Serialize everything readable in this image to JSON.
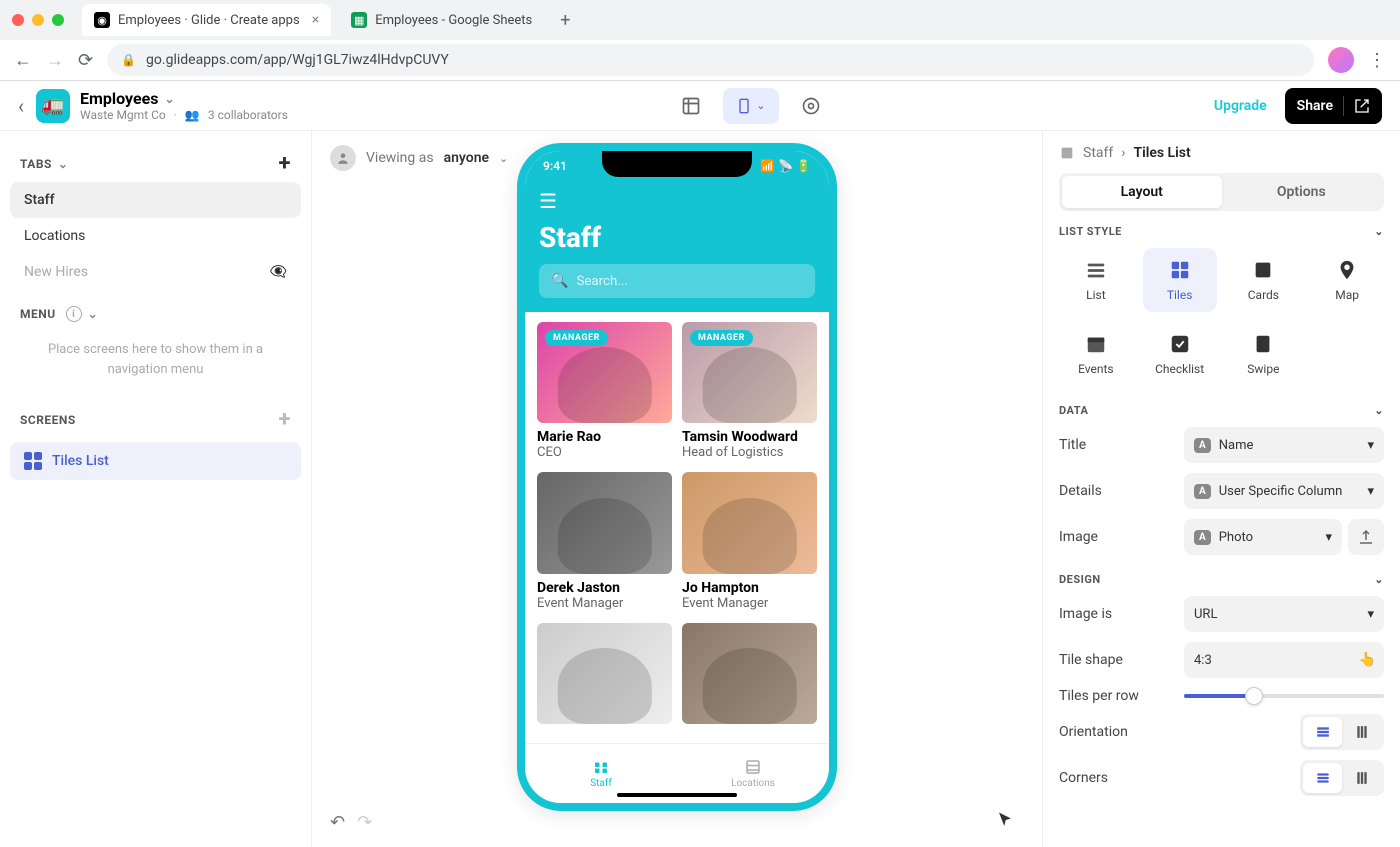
{
  "browser": {
    "tabs": [
      {
        "favicon": "◉",
        "title": "Employees · Glide · Create apps",
        "active": true
      },
      {
        "favicon": "▦",
        "title": "Employees - Google Sheets",
        "active": false
      }
    ],
    "url": "go.glideapps.com/app/Wgj1GL7iwz4lHdvpCUVY"
  },
  "app_header": {
    "title": "Employees",
    "org": "Waste Mgmt Co",
    "collaborators": "3 collaborators",
    "upgrade": "Upgrade",
    "share": "Share"
  },
  "left": {
    "tabs_label": "TABS",
    "tabs": [
      {
        "name": "Staff",
        "active": true
      },
      {
        "name": "Locations"
      },
      {
        "name": "New Hires",
        "hidden": true
      }
    ],
    "menu_label": "MENU",
    "menu_help": "Place screens here to show them in a navigation menu",
    "screens_label": "SCREENS",
    "screens": [
      {
        "name": "Tiles List",
        "active": true
      }
    ]
  },
  "viewing": {
    "prefix": "Viewing as",
    "who": "anyone"
  },
  "phone": {
    "time": "9:41",
    "title": "Staff",
    "search_placeholder": "Search...",
    "manager_badge": "MANAGER",
    "people": [
      {
        "name": "Marie Rao",
        "role": "CEO",
        "badge": true
      },
      {
        "name": "Tamsin Woodward",
        "role": "Head of Logistics",
        "badge": true
      },
      {
        "name": "Derek Jaston",
        "role": "Event Manager"
      },
      {
        "name": "Jo Hampton",
        "role": "Event Manager"
      }
    ],
    "nav": [
      {
        "label": "Staff",
        "active": true
      },
      {
        "label": "Locations"
      }
    ]
  },
  "right": {
    "crumb_root": "Staff",
    "crumb_current": "Tiles List",
    "layout_tab": "Layout",
    "options_tab": "Options",
    "list_style_label": "LIST STYLE",
    "styles": [
      "List",
      "Tiles",
      "Cards",
      "Map",
      "Events",
      "Checklist",
      "Swipe"
    ],
    "active_style": "Tiles",
    "data_label": "DATA",
    "data_rows": {
      "title": {
        "label": "Title",
        "value": "Name"
      },
      "details": {
        "label": "Details",
        "value": "User Specific Column"
      },
      "image": {
        "label": "Image",
        "value": "Photo"
      }
    },
    "design_label": "DESIGN",
    "design_rows": {
      "image_is": {
        "label": "Image is",
        "value": "URL"
      },
      "tile_shape": {
        "label": "Tile shape",
        "value": "4:3"
      },
      "tiles_per_row": {
        "label": "Tiles per row"
      },
      "orientation": {
        "label": "Orientation"
      },
      "corners": {
        "label": "Corners"
      }
    }
  }
}
